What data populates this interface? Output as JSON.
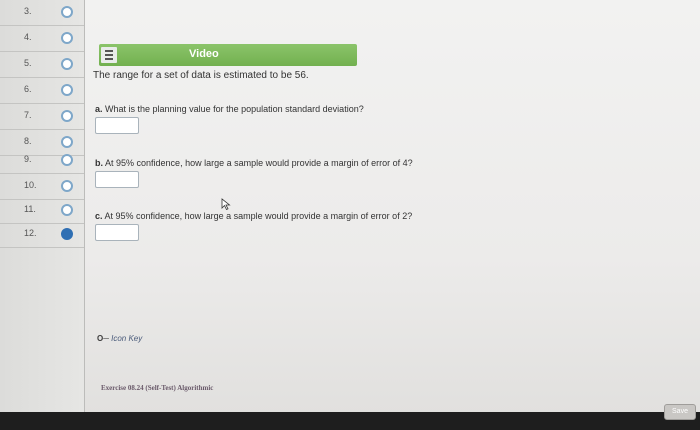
{
  "sidebar": {
    "questions": [
      {
        "number": "3.",
        "state": "unanswered"
      },
      {
        "number": "4.",
        "state": "unanswered"
      },
      {
        "number": "5.",
        "state": "unanswered"
      },
      {
        "number": "6.",
        "state": "unanswered"
      },
      {
        "number": "7.",
        "state": "unanswered"
      },
      {
        "number": "8.",
        "state": "unanswered"
      },
      {
        "number": "9.",
        "state": "unanswered"
      },
      {
        "number": "10.",
        "state": "unanswered"
      },
      {
        "number": "11.",
        "state": "unanswered"
      },
      {
        "number": "12.",
        "state": "current"
      }
    ]
  },
  "video": {
    "label": "Video",
    "icon": "film-icon",
    "color": "#7ab857"
  },
  "problem": {
    "intro": "The range for a set of data is estimated to be 56.",
    "parts": [
      {
        "letter": "a.",
        "text": "What is the planning value for the population standard deviation?",
        "value": ""
      },
      {
        "letter": "b.",
        "text": "At 95% confidence, how large a sample would provide a margin of error of 4?",
        "value": ""
      },
      {
        "letter": "c.",
        "text": "At 95% confidence, how large a sample would provide a margin of error of 2?",
        "value": ""
      }
    ]
  },
  "icon_key": {
    "icon": "key-icon",
    "label": "Icon Key"
  },
  "footer": {
    "exercise": "Exercise 08.24 (Self-Test) Algorithmic"
  },
  "save": {
    "label": "Save"
  },
  "colors": {
    "radio": "#7ea7c9",
    "radio_current": "#2f6fb3"
  }
}
